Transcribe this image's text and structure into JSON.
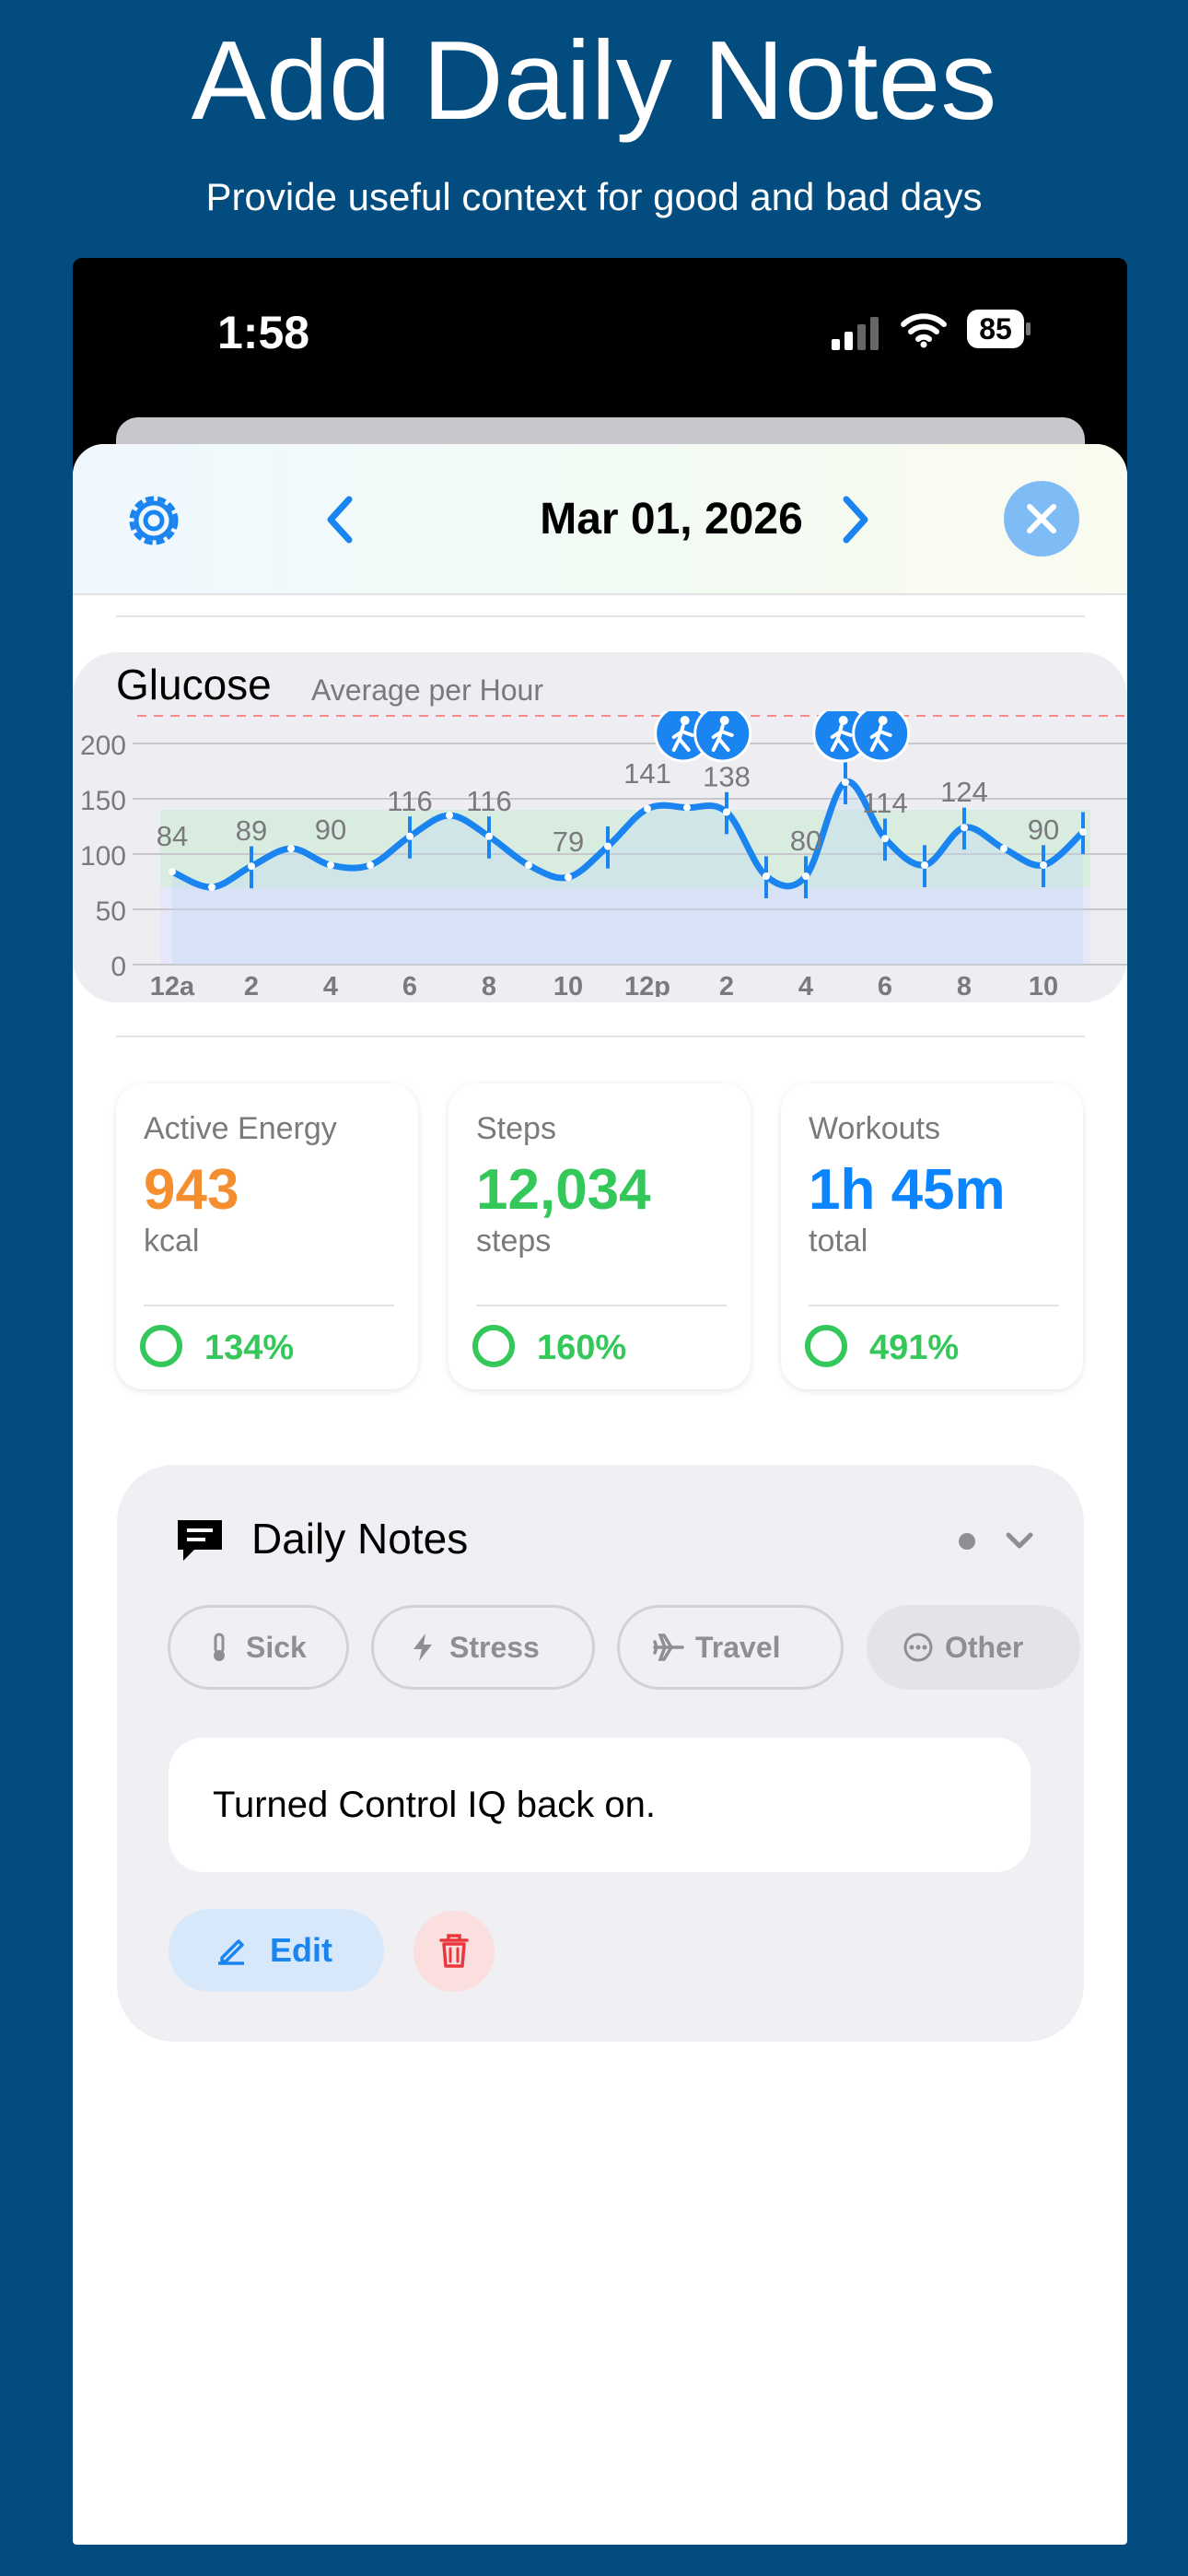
{
  "headline": "Add Daily Notes",
  "subheadline": "Provide useful context for good and bad days",
  "status_bar": {
    "time": "1:58",
    "battery": "85"
  },
  "nav": {
    "date": "Mar 01, 2026"
  },
  "colors": {
    "background": "#034C80",
    "accent_blue": "#1A84F0",
    "energy_orange": "#F58E2E",
    "steps_green": "#34C759",
    "workouts_blue": "#0A84FF",
    "target_band": "#D5EBDD",
    "high_threshold_line": "#F28B8B"
  },
  "glucose": {
    "title": "Glucose",
    "subtitle": "Average per Hour",
    "activity_icons": [
      "walking-icon",
      "walking-icon",
      "hiking-icon",
      "hiking-icon"
    ]
  },
  "chart_data": {
    "type": "line",
    "title": "Glucose",
    "subtitle": "Average per Hour",
    "x_tick_labels": [
      "12a",
      "2",
      "4",
      "6",
      "8",
      "10",
      "12p",
      "2",
      "4",
      "6",
      "8",
      "10"
    ],
    "y_ticks": [
      0,
      50,
      100,
      150,
      200
    ],
    "ylim": [
      0,
      200
    ],
    "target_range": [
      70,
      140
    ],
    "high_threshold": 225,
    "series": [
      {
        "hours": [
          0,
          1,
          2,
          3,
          4,
          5,
          6,
          7,
          8,
          9,
          10,
          11,
          12,
          13,
          14,
          15,
          16,
          17,
          18,
          19,
          20,
          21,
          22,
          23
        ],
        "values": [
          84,
          70,
          89,
          105,
          90,
          90,
          116,
          135,
          116,
          90,
          79,
          107,
          141,
          142,
          138,
          80,
          80,
          165,
          114,
          90,
          124,
          105,
          90,
          120
        ]
      }
    ],
    "annotations": [
      {
        "hour": 0,
        "label": "84"
      },
      {
        "hour": 2,
        "label": "89"
      },
      {
        "hour": 4,
        "label": "90"
      },
      {
        "hour": 6,
        "label": "116"
      },
      {
        "hour": 8,
        "label": "116"
      },
      {
        "hour": 10,
        "label": "79"
      },
      {
        "hour": 12,
        "label": "141"
      },
      {
        "hour": 14,
        "label": "138"
      },
      {
        "hour": 16,
        "label": "80"
      },
      {
        "hour": 18,
        "label": "114"
      },
      {
        "hour": 20,
        "label": "124"
      },
      {
        "hour": 22,
        "label": "90"
      }
    ],
    "grid": true
  },
  "metrics": [
    {
      "label": "Active Energy",
      "value": "943",
      "unit": "kcal",
      "percent": "134%"
    },
    {
      "label": "Steps",
      "value": "12,034",
      "unit": "steps",
      "percent": "160%"
    },
    {
      "label": "Workouts",
      "value": "1h 45m",
      "unit": "total",
      "percent": "491%"
    }
  ],
  "notes": {
    "title": "Daily Notes",
    "tags": [
      "Sick",
      "Stress",
      "Travel",
      "Other"
    ],
    "note_text": "Turned Control IQ back on.",
    "edit_label": "Edit"
  }
}
